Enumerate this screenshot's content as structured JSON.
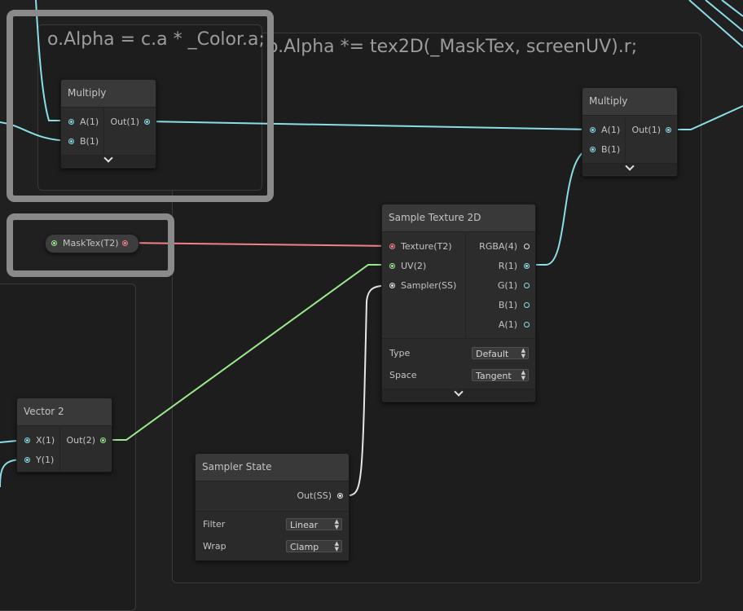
{
  "groups": {
    "left": {
      "title": "o.Alpha = c.a * _Color.a;"
    },
    "right": {
      "title": "o.Alpha *= tex2D(_MaskTex, screenUV).r;"
    }
  },
  "nodes": {
    "multiply_left": {
      "title": "Multiply",
      "inputs": [
        {
          "label": "A(1)"
        },
        {
          "label": "B(1)"
        }
      ],
      "output": {
        "label": "Out(1)"
      }
    },
    "multiply_right": {
      "title": "Multiply",
      "inputs": [
        {
          "label": "A(1)"
        },
        {
          "label": "B(1)"
        }
      ],
      "output": {
        "label": "Out(1)"
      }
    },
    "property": {
      "label": "MaskTex(T2)"
    },
    "sample_texture": {
      "title": "Sample Texture 2D",
      "inputs": [
        {
          "label": "Texture(T2)"
        },
        {
          "label": "UV(2)"
        },
        {
          "label": "Sampler(SS)"
        }
      ],
      "outputs": [
        {
          "label": "RGBA(4)"
        },
        {
          "label": "R(1)"
        },
        {
          "label": "G(1)"
        },
        {
          "label": "B(1)"
        },
        {
          "label": "A(1)"
        }
      ],
      "settings": [
        {
          "label": "Type",
          "value": "Default"
        },
        {
          "label": "Space",
          "value": "Tangent"
        }
      ]
    },
    "vector2": {
      "title": "Vector 2",
      "inputs": [
        {
          "label": "X(1)"
        },
        {
          "label": "Y(1)"
        }
      ],
      "output": {
        "label": "Out(2)"
      }
    },
    "sampler_state": {
      "title": "Sampler State",
      "output": {
        "label": "Out(SS)"
      },
      "settings": [
        {
          "label": "Filter",
          "value": "Linear"
        },
        {
          "label": "Wrap",
          "value": "Clamp"
        }
      ]
    }
  },
  "colors": {
    "background": "#202020",
    "float_wire": "#8bdde8",
    "texture_wire": "#f2808a",
    "vector2_wire": "#9be98d",
    "sampler_wire": "#e6e6e6"
  },
  "icons": {
    "expand": "chevron-down-icon",
    "dropdown": "dropdown-arrows-icon"
  }
}
